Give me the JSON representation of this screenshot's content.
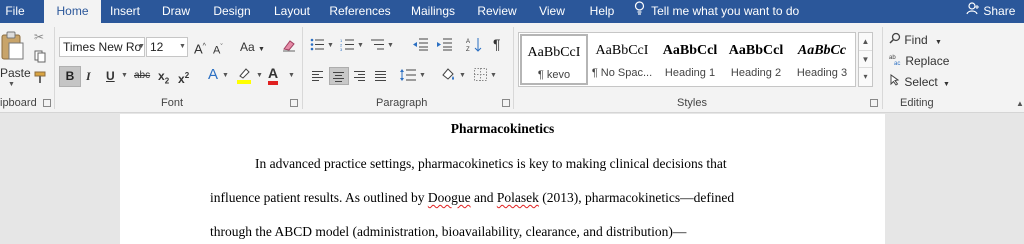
{
  "tabs": [
    "File",
    "Home",
    "Insert",
    "Draw",
    "Design",
    "Layout",
    "References",
    "Mailings",
    "Review",
    "View",
    "Help"
  ],
  "tell_me": "Tell me what you want to do",
  "share": "Share",
  "groups": {
    "clipboard": "ipboard",
    "font": "Font",
    "paragraph": "Paragraph",
    "styles": "Styles",
    "editing": "Editing"
  },
  "clipboard": {
    "paste": "Paste"
  },
  "font": {
    "name": "Times New Ro",
    "size": "12",
    "grow": "A",
    "shrink": "A",
    "case": "Aa",
    "bold": "B",
    "italic": "I",
    "underline": "U",
    "strike": "abc",
    "subscript": "x",
    "subscript_mark": "2",
    "superscript": "x",
    "superscript_mark": "2",
    "effects": "A",
    "color": "A"
  },
  "styles": [
    {
      "sample": "AaBbCcI",
      "name": "¶ kevo"
    },
    {
      "sample": "AaBbCcI",
      "name": "¶ No Spac..."
    },
    {
      "sample": "AaBbCcl",
      "name": "Heading 1"
    },
    {
      "sample": "AaBbCcl",
      "name": "Heading 2"
    },
    {
      "sample": "AaBbCc",
      "name": "Heading 3"
    }
  ],
  "editing": {
    "find": "Find",
    "replace": "Replace",
    "select": "Select"
  },
  "document": {
    "title": "Pharmacokinetics",
    "line1": "In advanced practice settings, pharmacokinetics is key to making clinical decisions that",
    "line2_a": "influence patient results. As outlined by ",
    "line2_b": "Doogue",
    "line2_c": " and ",
    "line2_d": "Polasek",
    "line2_e": " (2013), pharmacokinetics—defined",
    "line3": "through the ABCD model (administration, bioavailability, clearance, and distribution)—"
  },
  "colors": {
    "tab_bar": "#2b579a",
    "ribbon": "#f3f3f3",
    "highlight": "#ffff00",
    "font_color": "#e02020"
  }
}
